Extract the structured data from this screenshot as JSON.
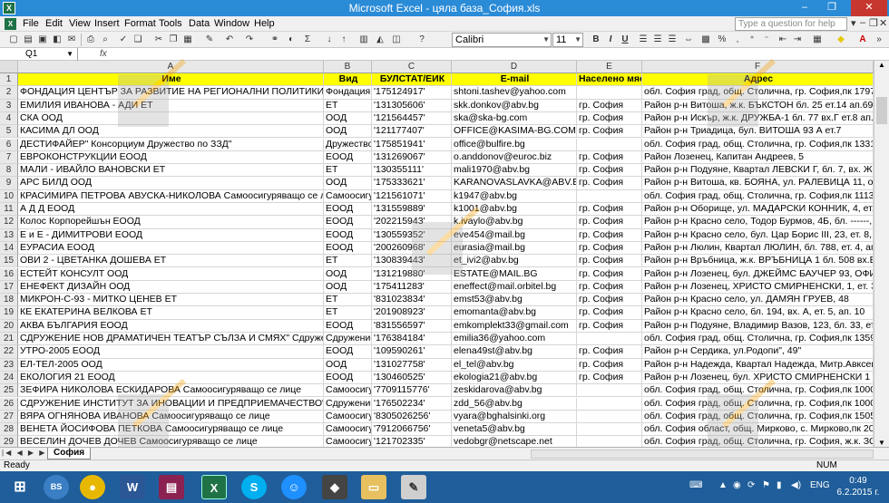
{
  "window": {
    "title": "Microsoft Excel - цяла база_София.xls",
    "app_icon": "X",
    "controls": [
      "–",
      "❐",
      "✕"
    ]
  },
  "menubar": {
    "items": [
      "File",
      "Edit",
      "View",
      "Insert",
      "Format",
      "Tools",
      "Data",
      "Window",
      "Help"
    ],
    "help_placeholder": "Type a question for help",
    "controls": [
      "▾",
      "–",
      "❐",
      "✕"
    ]
  },
  "toolbar": {
    "font_name": "Calibri",
    "font_size": "11",
    "sigma": "Σ",
    "bold": "B",
    "italic": "I",
    "underline": "U",
    "percent": "%"
  },
  "formula_bar": {
    "name_box": "Q1",
    "fx": "fx",
    "value": ""
  },
  "columns": [
    {
      "id": "A",
      "header": "Име"
    },
    {
      "id": "B",
      "header": "Вид"
    },
    {
      "id": "C",
      "header": "БУЛСТАТ/ЕИК"
    },
    {
      "id": "D",
      "header": "E-mail"
    },
    {
      "id": "E",
      "header": "Населено място"
    },
    {
      "id": "F",
      "header": "Адрес"
    }
  ],
  "rows": [
    {
      "n": "2",
      "a": "ФОНДАЦИЯ ЦЕНТЪР ЗА РАЗВИТИЕ НА РЕГИОНАЛНИ ПОЛИТИКИ\" Фондаци",
      "b": "Фондация",
      "c": "'175124917'",
      "d": "shtoni.tashev@yahoo.com",
      "e": "",
      "f": "обл. София град, общ. Столична, гр. София,пк 1797, ж."
    },
    {
      "n": "3",
      "a": "ЕМИЛИЯ ИВАНОВА - АДИ ЕТ",
      "b": "ЕТ",
      "c": "'131305606'",
      "d": "skk.donkov@abv.bg",
      "e": "гр. София",
      "f": "Район р-н Витоша, ж.к. БЪКСТОН бл. 25 ет.14 ап.69"
    },
    {
      "n": "4",
      "a": "СКА ООД",
      "b": "ООД",
      "c": "'121564457'",
      "d": "ska@ska-bg.com",
      "e": "гр. София",
      "f": "Район р-н Искър, ж.к. ДРУЖБА-1 бл. 77 вх.Г ет.8 ап.91"
    },
    {
      "n": "5",
      "a": "КАСИМА ДЛ ООД",
      "b": "ООД",
      "c": "'121177407'",
      "d": "OFFICE@KASIMA-BG.COM",
      "e": "гр. София",
      "f": "Район р-н Триадица, бул. ВИТОША 93 А ет.7"
    },
    {
      "n": "6",
      "a": "ДЕСТИФАЙЕР\" Консорциум Дружество по ЗЗД\"",
      "b": "Дружество",
      "c": "'175851941'",
      "d": "office@bulfire.bg",
      "e": "",
      "f": "обл. София град, общ. Столична, гр. София,пк 1331, ул. Л"
    },
    {
      "n": "7",
      "a": "ЕВРОКОНСТРУКЦИИ ЕООД",
      "b": "ЕООД",
      "c": "'131269067'",
      "d": "o.anddonov@euroc.biz",
      "e": "гр. София",
      "f": "Район Лозенец, Капитан Андреев, 5"
    },
    {
      "n": "8",
      "a": "МАЛИ - ИВАЙЛО ВАНОВСКИ ЕТ",
      "b": "ЕТ",
      "c": "'130355111'",
      "d": "mali1970@abv.bg",
      "e": "гр. София",
      "f": "Район р-н Подуяне, Квартал ЛЕВСКИ Г, бл. 7, вх. Ж, ет. 6"
    },
    {
      "n": "9",
      "a": "АРС БИЛД ООД",
      "b": "ООД",
      "c": "'175333621'",
      "d": "KARANOVASLAVKA@ABV.BG",
      "e": "гр. София",
      "f": "Район р-н Витоша, кв. БОЯНА, ул. РАЛЕВИЦА 11, офис 1"
    },
    {
      "n": "10",
      "a": "КРАСИМИРА ПЕТРОВА АВУСКА-НИКОЛОВА Самоосигуряващо се лице",
      "b": "Самоосигур",
      "c": "'121561071'",
      "d": "k1947@abv.bg",
      "e": "",
      "f": "обл. София град, общ. Столична, гр. София,пк 1113, ул. В"
    },
    {
      "n": "11",
      "a": "А Д Д ЕООД",
      "b": "ЕООД",
      "c": "'131559889'",
      "d": "k1001@abv.bg",
      "e": "гр. София",
      "f": "Район р-н Оборище, ул. МАДАРСКИ КОННИК, 4, ет. 4, ап"
    },
    {
      "n": "12",
      "a": "Колос Корпорейшън ЕООД",
      "b": "ЕООД",
      "c": "'202215943'",
      "d": "k.ivaylo@abv.bg",
      "e": "гр. София",
      "f": "Район р-н Красно село, Тодор Бурмов, 4Б, бл. ------, вх. -"
    },
    {
      "n": "13",
      "a": "Е и Е - ДИМИТРОВИ ЕООД",
      "b": "ЕООД",
      "c": "'130559352'",
      "d": "eve454@mail.bg",
      "e": "гр. София",
      "f": "Район р-н Красно село, бул. Цар Борис III, 23, ет. 8, ап. 1"
    },
    {
      "n": "14",
      "a": "ЕУРАСИА ЕООД",
      "b": "ЕООД",
      "c": "'200260968'",
      "d": "eurasia@mail.bg",
      "e": "гр. София",
      "f": "Район р-н Люлин, Квартал ЛЮЛИН, бл. 788, ет. 4, ап. 15"
    },
    {
      "n": "15",
      "a": "ОВИ 2 - ЦВЕТАНКА ДОШЕВА ЕТ",
      "b": "ЕТ",
      "c": "'130839443'",
      "d": "et_ivi2@abv.bg",
      "e": "гр. София",
      "f": "Район р-н Връбница, ж.к. ВРЪБНИЦА 1 бл. 508 вх.В ап.58"
    },
    {
      "n": "16",
      "a": "ЕСТЕЙТ КОНСУЛТ ООД",
      "b": "ООД",
      "c": "'131219880'",
      "d": "ESTATE@MAIL.BG",
      "e": "гр. София",
      "f": "Район р-н Лозенец, бул. ДЖЕЙМС БАУЧЕР 93, ОФИС 1"
    },
    {
      "n": "17",
      "a": "ЕНЕФЕКТ ДИЗАЙН ООД",
      "b": "ООД",
      "c": "'175411283'",
      "d": "eneffect@mail.orbitel.bg",
      "e": "гр. София",
      "f": "Район р-н Лозенец, ХРИСТО СМИРНЕНСКИ, 1, ет. 3"
    },
    {
      "n": "18",
      "a": "МИКРОН-С-93 - МИТКО ЦЕНЕВ ЕТ",
      "b": "ЕТ",
      "c": "'831023834'",
      "d": "emst53@abv.bg",
      "e": "гр. София",
      "f": "Район р-н Красно село, ул. ДАМЯН ГРУЕВ, 48"
    },
    {
      "n": "19",
      "a": "КЕ ЕКАТЕРИНА ВЕЛКОВА ЕТ",
      "b": "ЕТ",
      "c": "'201908923'",
      "d": "emomanta@abv.bg",
      "e": "гр. София",
      "f": "Район р-н Красно село, бл. 194, вх. А, ет. 5, ап. 10"
    },
    {
      "n": "20",
      "a": "АКВА БЪЛГАРИЯ ЕООД",
      "b": "ЕООД",
      "c": "'831556597'",
      "d": "emkomplekt33@gmail.com",
      "e": "гр. София",
      "f": "Район р-н Подуяне, Владимир Вазов, 123, бл. 33, ет. 8, а"
    },
    {
      "n": "21",
      "a": "СДРУЖЕНИЕ НОВ ДРАМАТИЧЕН ТЕАТЪР СЪЛЗА И СМЯХ\" Сдружение\"",
      "b": "Сдружение",
      "c": "'176384184'",
      "d": "emilia36@yahoo.com",
      "e": "",
      "f": "обл. София град, общ. Столична, гр. София,пк 1359, ж.к."
    },
    {
      "n": "22",
      "a": "УТРО-2005 ЕООД",
      "b": "ЕООД",
      "c": "'109590261'",
      "d": "elena49st@abv.bg",
      "e": "гр. София",
      "f": "Район р-н Сердика, ул.Родопи\", 49\""
    },
    {
      "n": "23",
      "a": "ЕЛ-ТЕЛ-2005 ООД",
      "b": "ООД",
      "c": "'131027758'",
      "d": "el_tel@abv.bg",
      "e": "гр. София",
      "f": "Район р-н Надежда, Квартал Надежда, Митр.Авксентий"
    },
    {
      "n": "24",
      "a": "ЕКОЛОГИЯ 21 ЕООД",
      "b": "ЕООД",
      "c": "'130460525'",
      "d": "ekologia21@abv.bg",
      "e": "гр. София",
      "f": "Район р-н Лозенец, бул. ХРИСТО СМИРНЕНСКИ 1 бл. Б"
    },
    {
      "n": "25",
      "a": "ЗЕФИРА НИКОЛОВА ЕСКИДАРОВА Самоосигуряващо се лице",
      "b": "Самоосигур",
      "c": "'7709115776'",
      "d": "zeskidarova@abv.bg",
      "e": "",
      "f": "обл. София град, общ. Столична, гр. София,пк 1000, ул. А"
    },
    {
      "n": "26",
      "a": "СДРУЖЕНИЕ ИНСТИТУТ ЗА ИНОВАЦИИ И ПРЕДПРИЕМАЧЕСТВО\" Сдружен",
      "b": "Сдружение",
      "c": "'176502234'",
      "d": "zdd_56@abv.bg",
      "e": "",
      "f": "обл. София град, общ. Столична, гр. София,пк 1000, ул. М"
    },
    {
      "n": "27",
      "a": "ВЯРА ОГНЯНОВА ИВАНОВА Самоосигуряващо се лице",
      "b": "Самоосигур",
      "c": "'8305026256'",
      "d": "vyara@bghalsinki.org",
      "e": "",
      "f": "обл. София град, общ. Столична, гр. София,пк 1505, ул. В"
    },
    {
      "n": "28",
      "a": "ВЕНЕТА ЙОСИФОВА ПЕТКОВА Самоосигуряващо се лице",
      "b": "Самоосигур",
      "c": "'7912066756'",
      "d": "veneta5@abv.bg",
      "e": "",
      "f": "обл. София област, общ. Мирково, с. Мирково,пк 2095, у"
    },
    {
      "n": "29",
      "a": "ВЕСЕЛИН ДОЧЕВ ДОЧЕВ Самоосигуряващо се лице",
      "b": "Самоосигур",
      "c": "'121702335'",
      "d": "vedobgr@netscape.net",
      "e": "",
      "f": "обл. София град, общ. Столична, гр. София, ж.к. ЗОНА Б"
    }
  ],
  "sheet_tabs": [
    "София"
  ],
  "status": {
    "ready": "Ready",
    "num": "NUM"
  },
  "taskbar": {
    "lang": "ENG",
    "time": "0:49",
    "date": "6.2.2015 г."
  }
}
